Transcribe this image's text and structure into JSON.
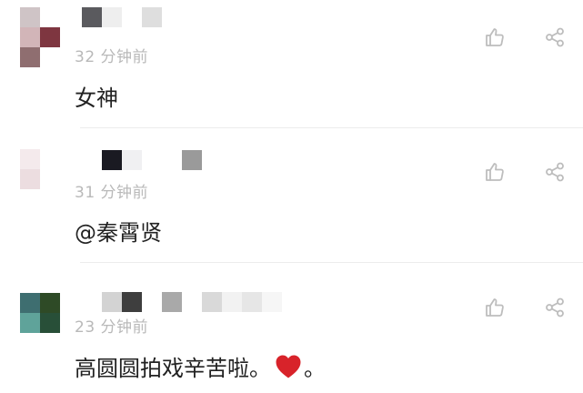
{
  "comments": [
    {
      "time": "32 分钟前",
      "text": "女神",
      "avatar_colors": [
        "#cfc4c6",
        "#ffffff",
        "#d2b5b8",
        "#7e3640"
      ],
      "name_colors": [
        "#5a5a5e",
        "#eeeeee",
        "#ffffff",
        "#dedede"
      ]
    },
    {
      "time": "31 分钟前",
      "text": "@秦霄贤",
      "avatar_colors": [
        "#f4eaec",
        "#ffffff",
        "#ecdde0",
        "#ffffff"
      ],
      "name_colors": [
        "#1a1a22",
        "#f0f0f2",
        "#ffffff",
        "#ffffff",
        "#9a9a9a"
      ]
    },
    {
      "time": "23 分钟前",
      "text": "高圆圆拍戏辛苦啦。",
      "text_after": "。",
      "avatar_colors": [
        "#3e6e70",
        "#2e4a26",
        "#5fa39a",
        "#284f38"
      ],
      "name_colors": [
        "#d3d3d3",
        "#3e3e3e",
        "#ffffff",
        "#a9a9a9",
        "#ebebeb",
        "#d9d9d9",
        "#f2f2f2",
        "#e6e6e6",
        "#f6f6f6"
      ]
    }
  ],
  "icons": {
    "like": "thumbs-up-icon",
    "share": "share-icon",
    "heart": "heart-emoji"
  },
  "colors": {
    "icon": "#bdbdbd",
    "time": "#b9b9b9",
    "heart": "#d8232a"
  }
}
